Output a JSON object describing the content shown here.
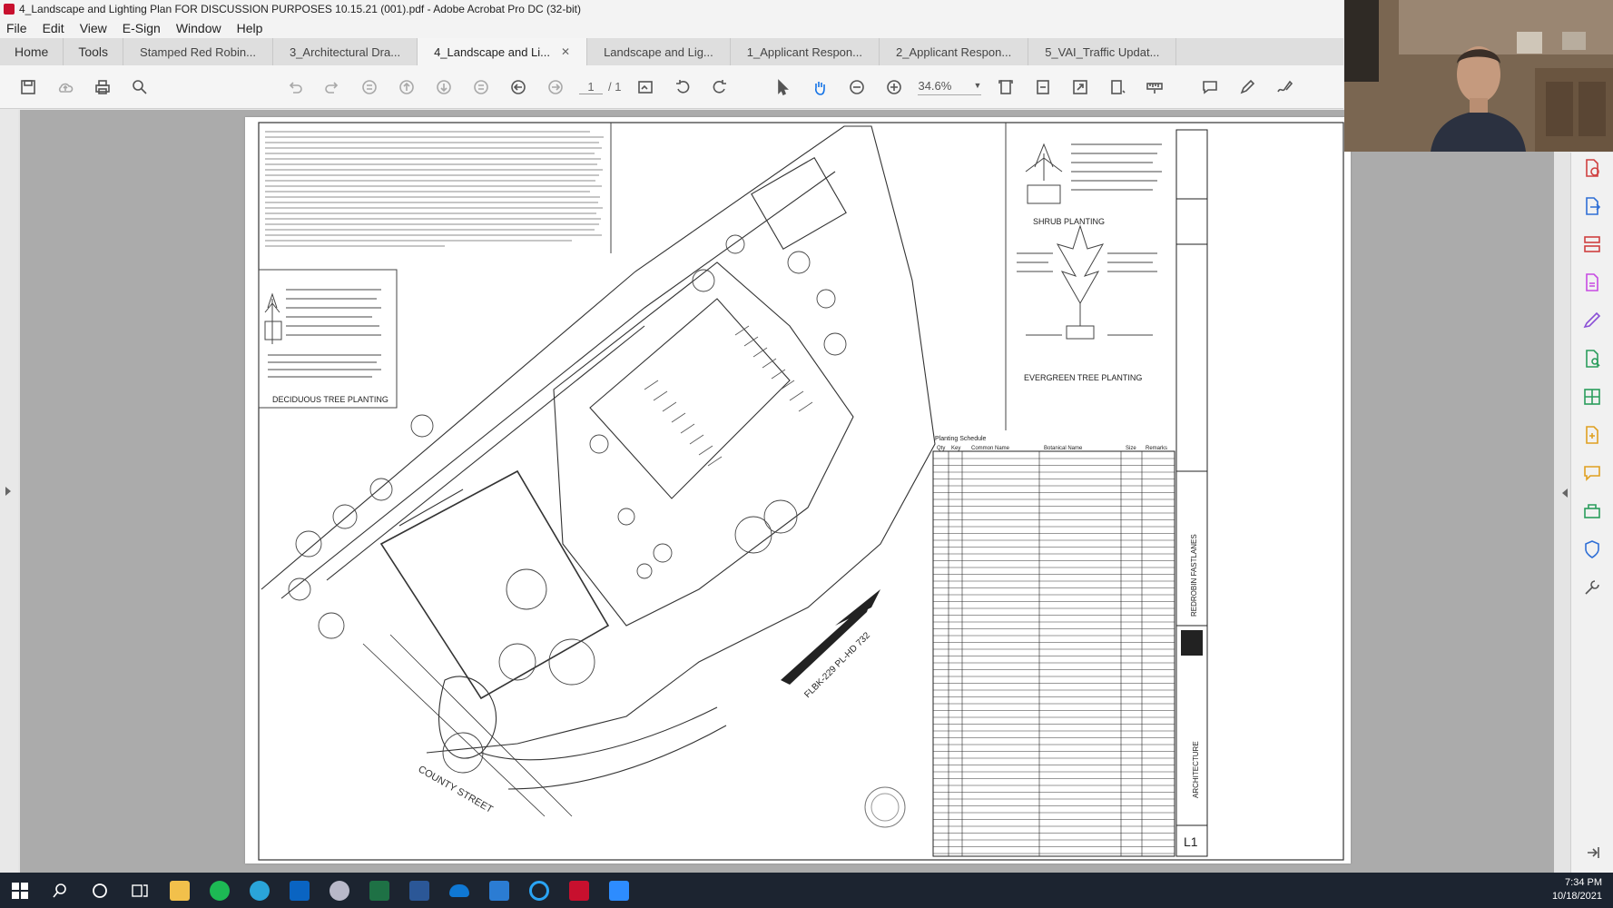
{
  "window": {
    "title": "4_Landscape and Lighting Plan FOR DISCUSSION PURPOSES 10.15.21 (001).pdf - Adobe Acrobat Pro DC (32-bit)"
  },
  "menu": [
    "File",
    "Edit",
    "View",
    "E-Sign",
    "Window",
    "Help"
  ],
  "nav_tabs": [
    "Home",
    "Tools"
  ],
  "doc_tabs": [
    {
      "label": "Stamped Red Robin..."
    },
    {
      "label": "3_Architectural Dra..."
    },
    {
      "label": "4_Landscape and Li...",
      "active": true
    },
    {
      "label": "Landscape and Lig..."
    },
    {
      "label": "1_Applicant Respon..."
    },
    {
      "label": "2_Applicant Respon..."
    },
    {
      "label": "5_VAI_Traffic Updat..."
    }
  ],
  "toolbar": {
    "page_current": "1",
    "page_total": "/ 1",
    "zoom": "34.6%"
  },
  "drawing": {
    "detail_deciduous": "DECIDUOUS TREE PLANTING",
    "detail_shrub": "SHRUB PLANTING",
    "detail_evergreen": "EVERGREEN TREE PLANTING",
    "schedule_title": "Planting Schedule",
    "schedule_headers": [
      "Qty",
      "Key",
      "Common Name",
      "Botanical Name",
      "Size",
      "Remarks"
    ],
    "road_label": "COUNTY STREET",
    "highway_label": "FLBK-229 PL-HD 732",
    "sheet_number": "L1",
    "firm_name": "ARCHITECTURE",
    "project_name": "REDROBIN FASTLANES"
  },
  "clock": {
    "time": "7:34 PM",
    "date": "10/18/2021"
  },
  "colors": {
    "taskbar": "#1c2430",
    "acrobat_red": "#c8102e",
    "sidebar_icon": "#d04040"
  }
}
